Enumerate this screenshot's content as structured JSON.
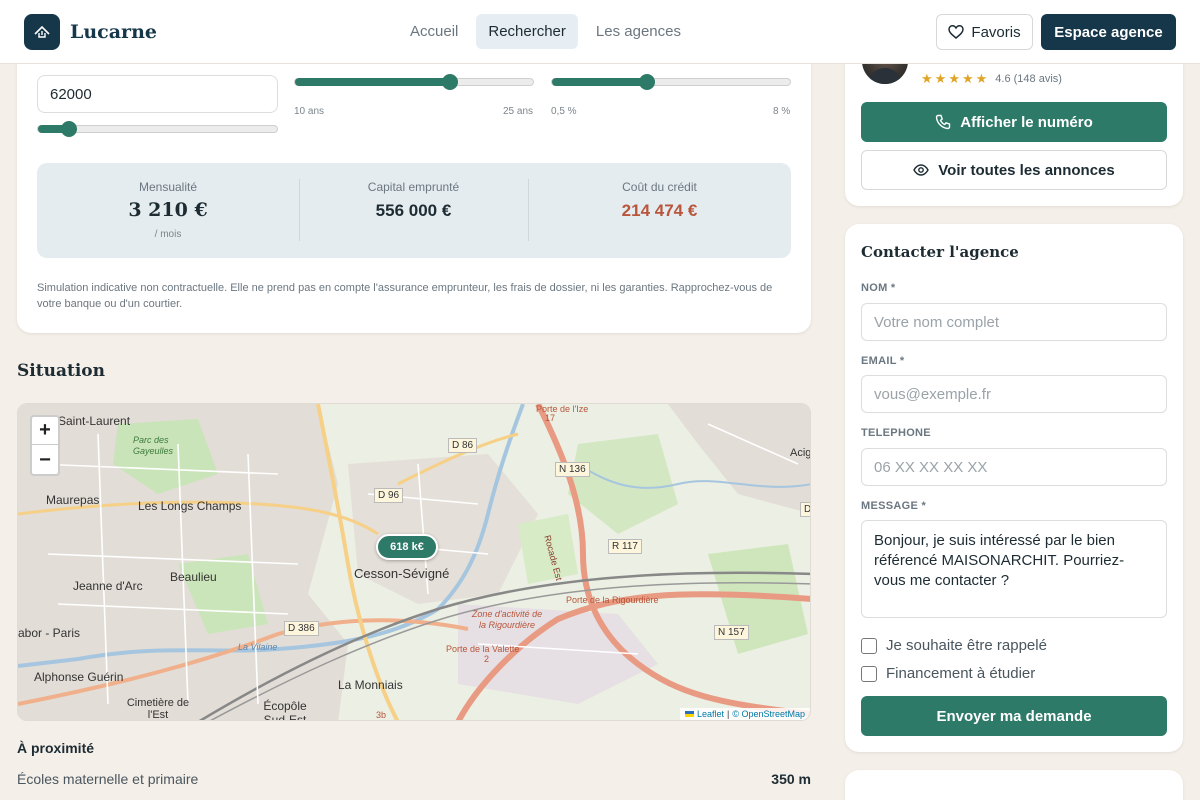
{
  "header": {
    "logo_text": "Lucarne",
    "nav": [
      "Accueil",
      "Rechercher",
      "Les agences"
    ],
    "active_nav": "Rechercher",
    "favorites_label": "Favoris",
    "agency_space_label": "Espace agence"
  },
  "simulator": {
    "apport_value": "62000",
    "apport_slider_fraction": 0.13,
    "duration_slider_fraction": 0.65,
    "duration_range": [
      "10 ans",
      "25 ans"
    ],
    "rate_slider_fraction": 0.4,
    "rate_range": [
      "0,5 %",
      "8 %"
    ],
    "results": {
      "monthly_label": "Mensualité",
      "monthly_value": "3 210 €",
      "monthly_unit": "/ mois",
      "capital_label": "Capital emprunté",
      "capital_value": "556 000 €",
      "cost_label": "Coût du crédit",
      "cost_value": "214 474 €"
    },
    "disclaimer": "Simulation indicative non contractuelle. Elle ne prend pas en compte l'assurance emprunteur, les frais de dossier, ni les garanties. Rapprochez-vous de votre banque ou d'un courtier."
  },
  "situation": {
    "title": "Situation",
    "map": {
      "zoom_in": "+",
      "zoom_out": "−",
      "price_marker": "618 k€",
      "place_labels": [
        "Saint-Laurent",
        "Parc des Gayeulles",
        "Maurepas",
        "Les Longs Champs",
        "Jeanne d'Arc",
        "Beaulieu",
        "abor - Paris",
        "Cesson-Sévigné",
        "Alphonse Guérin",
        "Cimetière de l'Est",
        "Écopôle Sud-Est",
        "La Monniais",
        "Acig",
        "Zone d'activité de la Rigourdière",
        "Porte de la Rigourdière",
        "Porte de la Valette",
        "Porte de l'Ize",
        "La Vilaine",
        "Rocade Est"
      ],
      "road_labels": [
        "D 86",
        "D 96",
        "N 136",
        "R 117",
        "D 386",
        "N 157",
        "D",
        "17",
        "2",
        "3b"
      ],
      "attribution_leaflet": "Leaflet",
      "attribution_osm": "© OpenStreetMap"
    },
    "proximity_title": "À proximité",
    "proximity": [
      {
        "label": "Écoles maternelle et primaire",
        "distance": "350 m"
      }
    ]
  },
  "agent": {
    "rating": "4.6 (148 avis)",
    "stars": 5,
    "show_number_label": "Afficher le numéro",
    "all_listings_label": "Voir toutes les annonces"
  },
  "contact": {
    "title": "Contacter l'agence",
    "name_label": "NOM *",
    "name_placeholder": "Votre nom complet",
    "email_label": "EMAIL *",
    "email_placeholder": "vous@exemple.fr",
    "phone_label": "TELEPHONE",
    "phone_placeholder": "06 XX XX XX XX",
    "message_label": "MESSAGE *",
    "message_value": "Bonjour, je suis intéressé par le bien référencé MAISONARCHIT. Pourriez-vous me contacter ?",
    "callback_label": "Je souhaite être rappelé",
    "financing_label": "Financement à étudier",
    "submit_label": "Envoyer ma demande"
  },
  "colors": {
    "primary": "#2e7a68",
    "navy": "#16374a",
    "cost_red": "#b8553a",
    "background": "#f4efe8"
  }
}
